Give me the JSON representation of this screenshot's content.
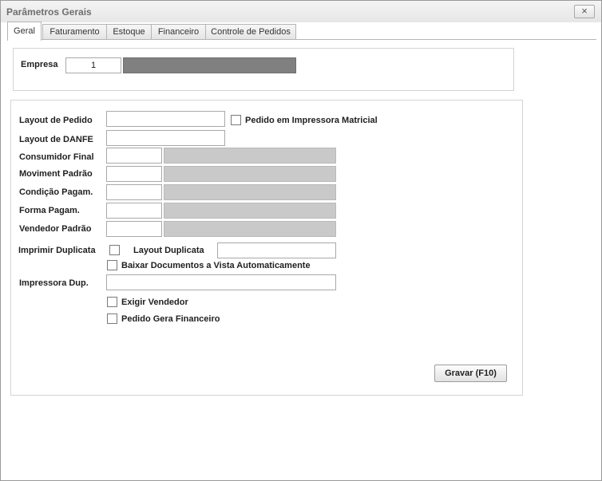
{
  "window": {
    "title": "Parâmetros Gerais",
    "close_glyph": "×"
  },
  "tabs": [
    {
      "label": "Geral",
      "active": true
    },
    {
      "label": "Faturamento",
      "active": false
    },
    {
      "label": "Estoque",
      "active": false
    },
    {
      "label": "Financeiro",
      "active": false
    },
    {
      "label": "Controle de Pedidos",
      "active": false
    }
  ],
  "empresa": {
    "label": "Empresa",
    "code": "1",
    "name": ""
  },
  "form": {
    "layout_pedido": {
      "label": "Layout de Pedido",
      "value": ""
    },
    "pedido_matricial": {
      "label": "Pedido em Impressora Matricial",
      "checked": false
    },
    "layout_danfe": {
      "label": "Layout de DANFE",
      "value": ""
    },
    "consumidor_final": {
      "label": "Consumidor Final",
      "code": "",
      "desc": ""
    },
    "moviment_padrao": {
      "label": "Moviment Padrão",
      "code": "",
      "desc": ""
    },
    "condicao_pagam": {
      "label": "Condição Pagam.",
      "code": "",
      "desc": ""
    },
    "forma_pagam": {
      "label": "Forma Pagam.",
      "code": "",
      "desc": ""
    },
    "vendedor_padrao": {
      "label": "Vendedor Padrão",
      "code": "",
      "desc": ""
    },
    "imprimir_duplicata": {
      "label": "Imprimir Duplicata",
      "checked": false
    },
    "layout_duplicata": {
      "label": "Layout Duplicata",
      "value": ""
    },
    "baixar_documentos": {
      "label": "Baixar Documentos a Vista Automaticamente",
      "checked": false
    },
    "impressora_dup": {
      "label": "Impressora Dup.",
      "value": ""
    },
    "exigir_vendedor": {
      "label": "Exigir Vendedor",
      "checked": false
    },
    "pedido_gera_financeiro": {
      "label": "Pedido Gera Financeiro",
      "checked": false
    }
  },
  "buttons": {
    "save_label": "Gravar (F10)"
  }
}
